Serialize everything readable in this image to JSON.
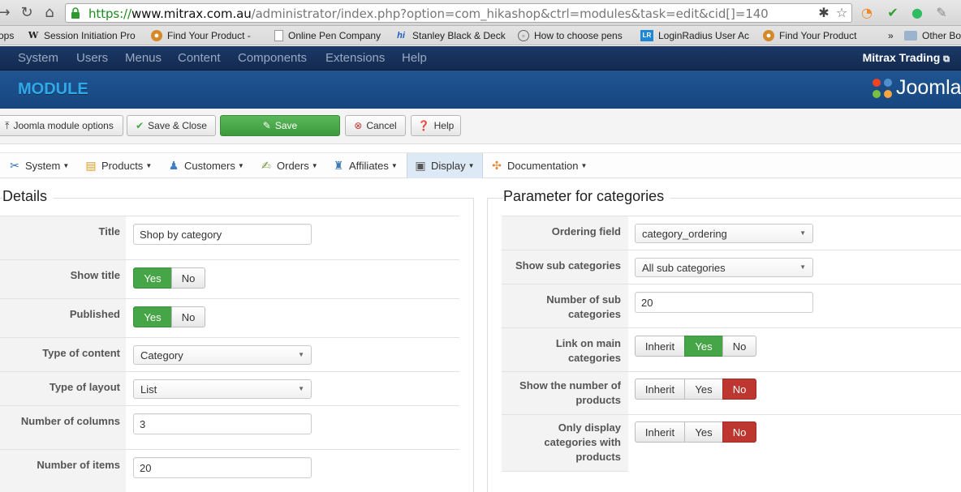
{
  "browser": {
    "url_scheme": "https://",
    "url_host": "www.mitrax.com.au",
    "url_path": "/administrator/index.php?option=com_hikashop&ctrl=modules&task=edit&cid[]=140",
    "bookmarks": [
      {
        "label": "ops",
        "icon": ""
      },
      {
        "label": "Session Initiation Pro",
        "icon": "W"
      },
      {
        "label": "Find Your Product -",
        "icon": "lion"
      },
      {
        "label": "Online Pen Company",
        "icon": "page"
      },
      {
        "label": "Stanley Black & Deck",
        "icon": "hi"
      },
      {
        "label": "How to choose pens",
        "icon": "compass"
      },
      {
        "label": "LoginRadius User Ac",
        "icon": "LR"
      },
      {
        "label": "Find Your Product",
        "icon": "lion"
      },
      {
        "label": "»",
        "icon": ""
      },
      {
        "label": "Other Bo",
        "icon": "folder"
      }
    ]
  },
  "topmenu": {
    "items": [
      "System",
      "Users",
      "Menus",
      "Content",
      "Components",
      "Extensions",
      "Help"
    ],
    "site_name": "Mitrax Trading"
  },
  "header": {
    "title": "MODULE",
    "logo_text": "Joomla"
  },
  "toolbar": {
    "options": "Joomla module options",
    "save_close": "Save & Close",
    "save": "Save",
    "cancel": "Cancel",
    "help": "Help"
  },
  "hikamenu": [
    "System",
    "Products",
    "Customers",
    "Orders",
    "Affiliates",
    "Display",
    "Documentation"
  ],
  "details": {
    "legend": "Details",
    "title_label": "Title",
    "title_value": "Shop by category",
    "show_title_label": "Show title",
    "published_label": "Published",
    "type_content_label": "Type of content",
    "type_content_value": "Category",
    "type_layout_label": "Type of layout",
    "type_layout_value": "List",
    "columns_label": "Number of columns",
    "columns_value": "3",
    "items_label": "Number of items",
    "items_value": "20"
  },
  "params": {
    "legend": "Parameter for categories",
    "ordering_label": "Ordering field",
    "ordering_value": "category_ordering",
    "subcat_label": "Show sub categories",
    "subcat_value": "All sub categories",
    "num_sub_label_1": "Number of sub",
    "num_sub_label_2": "categories",
    "num_sub_value": "20",
    "link_label_1": "Link on main",
    "link_label_2": "categories",
    "shownum_label_1": "Show the number of",
    "shownum_label_2": "products",
    "only_label_1": "Only display",
    "only_label_2": "categories with",
    "only_label_3": "products"
  },
  "toggles": {
    "yes": "Yes",
    "no": "No",
    "inherit": "Inherit"
  },
  "colors": {
    "top_menu": "#1a3867",
    "header": "#1f5593",
    "title_blue": "#2fa9e7",
    "yes_green": "#46a546",
    "no_red": "#bd362f"
  }
}
